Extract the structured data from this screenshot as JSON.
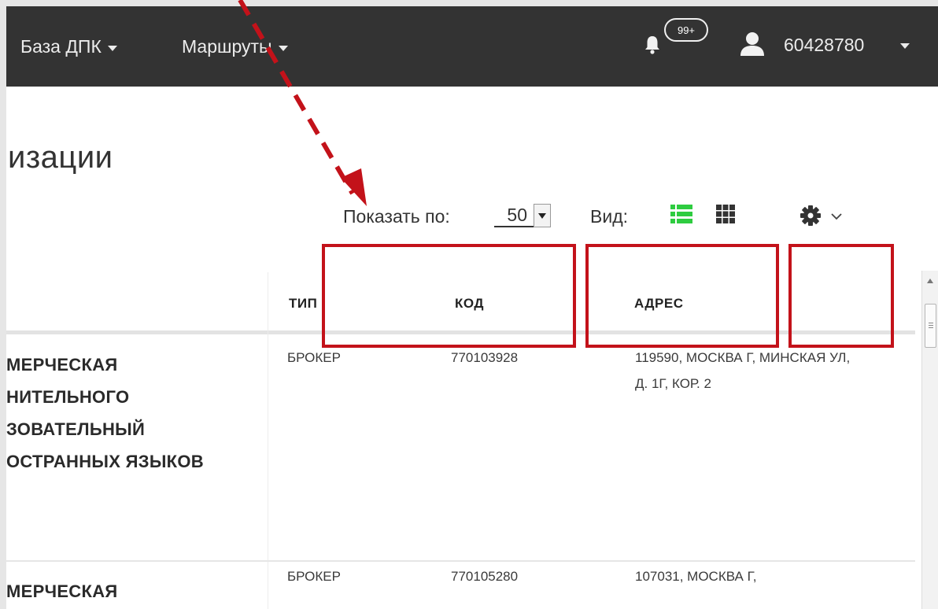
{
  "navbar": {
    "items": [
      {
        "label": "База ДПК"
      },
      {
        "label": "Маршруты"
      }
    ],
    "notifications_badge": "99+",
    "user_id": "60428780"
  },
  "page": {
    "title": "изации"
  },
  "toolbar": {
    "show_per_page_label": "Показать по:",
    "show_per_page_value": "50",
    "view_label": "Вид:"
  },
  "table": {
    "columns": [
      "ТИП",
      "КОД",
      "АДРЕС"
    ],
    "rows": [
      {
        "name_lines": [
          "МЕРЧЕСКАЯ",
          "НИТЕЛЬНОГО",
          "ЗОВАТЕЛЬНЫЙ",
          "ОСТРАННЫХ ЯЗЫКОВ"
        ],
        "type": "БРОКЕР",
        "code": "770103928",
        "address_lines": [
          "119590, МОСКВА Г, МИНСКАЯ УЛ,",
          "Д. 1Г, КОР. 2"
        ]
      },
      {
        "name_lines": [
          "МЕРЧЕСКАЯ"
        ],
        "type": "БРОКЕР",
        "code": "770105280",
        "address_lines": [
          "107031, МОСКВА Г,"
        ]
      }
    ]
  },
  "icons": {
    "bell": "bell-icon",
    "user": "user-icon",
    "list_view": "list-view-icon",
    "grid_view": "grid-view-icon",
    "settings": "gear-icon"
  },
  "colors": {
    "navbar_bg": "#333333",
    "annotation_red": "#c3121a",
    "active_view_green": "#2ecc40"
  }
}
